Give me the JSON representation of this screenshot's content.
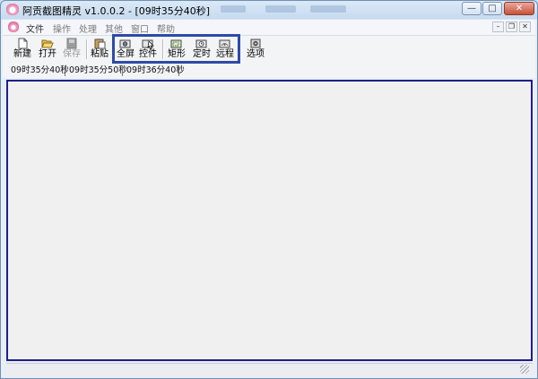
{
  "window": {
    "title": "阿贡截图精灵 v1.0.0.2 - [09时35分40秒]",
    "caption_buttons": {
      "minimize": "—",
      "maximize": "□",
      "close": "✕"
    }
  },
  "menu": {
    "items": [
      {
        "label": "文件",
        "enabled": true
      },
      {
        "label": "操作",
        "enabled": false
      },
      {
        "label": "处理",
        "enabled": false
      },
      {
        "label": "其他",
        "enabled": false
      },
      {
        "label": "窗口",
        "enabled": false
      },
      {
        "label": "帮助",
        "enabled": false
      }
    ],
    "mdi_buttons": {
      "minimize": "–",
      "restore": "❐",
      "close": "✕"
    }
  },
  "toolbar": {
    "new_label": "新建",
    "open_label": "打开",
    "save_label": "保存",
    "paste_label": "粘贴",
    "fullscreen_label": "全屏",
    "control_label": "控件",
    "rect_label": "矩形",
    "timer_label": "定时",
    "remote_label": "远程",
    "options_label": "选项",
    "icons": {
      "new": "new-file-icon",
      "open": "open-folder-icon",
      "save": "save-icon",
      "paste": "paste-icon",
      "fullscreen": "fullscreen-capture-icon",
      "control": "control-capture-icon",
      "rect": "rect-capture-icon",
      "timer": "timer-capture-icon",
      "remote": "remote-capture-icon",
      "options": "options-icon"
    }
  },
  "tabs": [
    {
      "label": "09时35分40秒"
    },
    {
      "label": "09时35分50秒"
    },
    {
      "label": "09时36分40秒"
    }
  ],
  "colors": {
    "highlight_border": "#2e4aa8",
    "canvas_border": "#1e1e8c"
  }
}
